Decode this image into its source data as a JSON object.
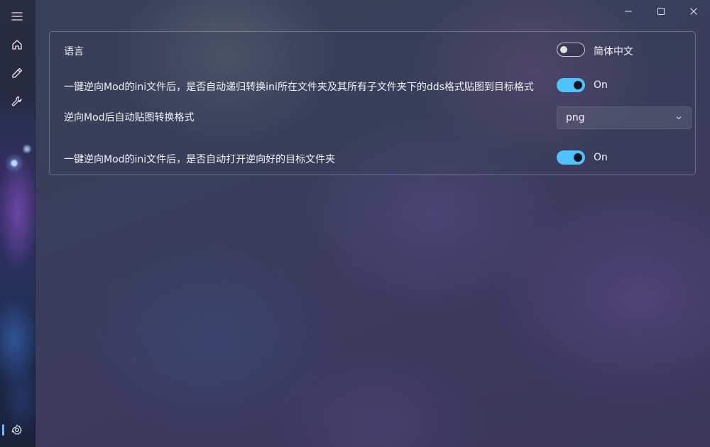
{
  "nav": {
    "items": [
      {
        "icon": "hamburger-menu-icon"
      },
      {
        "icon": "home-icon"
      },
      {
        "icon": "pencil-icon"
      },
      {
        "icon": "wrench-icon"
      },
      {
        "icon": "gear-icon",
        "selected": true
      }
    ]
  },
  "window": {
    "controls": [
      "minimize",
      "maximize",
      "close"
    ]
  },
  "settings": {
    "language": {
      "label": "语言",
      "toggle_on": false,
      "value_text": "简体中文"
    },
    "auto_convert_dds": {
      "label": "一键逆向Mod的ini文件后，是否自动递归转换ini所在文件夹及其所有子文件夹下的dds格式贴图到目标格式",
      "toggle_on": true,
      "state_text": "On"
    },
    "texture_format": {
      "label": "逆向Mod后自动贴图转换格式",
      "selected_value": "png"
    },
    "auto_open_folder": {
      "label": "一键逆向Mod的ini文件后，是否自动打开逆向好的目标文件夹",
      "toggle_on": true,
      "state_text": "On"
    }
  },
  "colors": {
    "accent": "#4cc2ff",
    "text": "#f2f2f5"
  }
}
